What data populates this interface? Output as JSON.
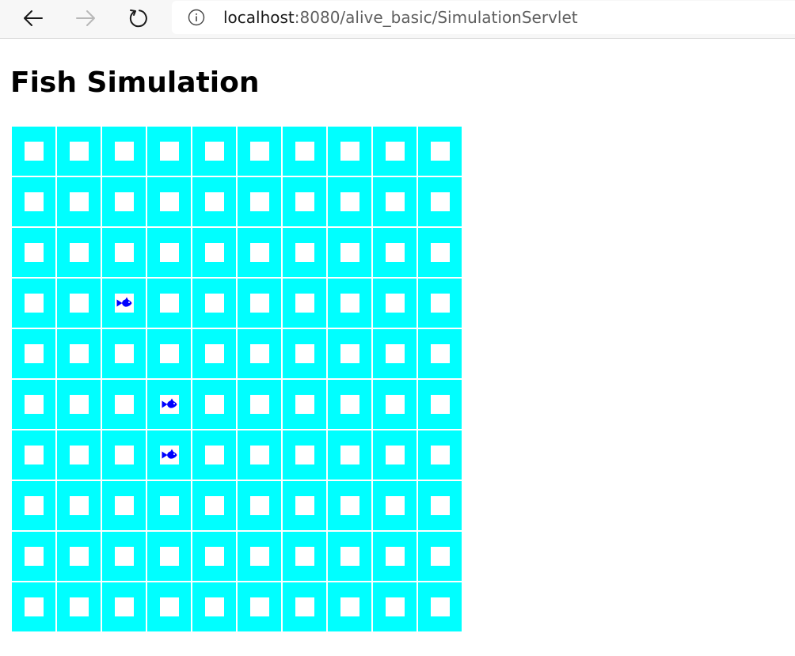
{
  "browser": {
    "url_host": "localhost",
    "url_rest": ":8080/alive_basic/SimulationServlet",
    "icons": {
      "back": "back-arrow-icon",
      "forward": "forward-arrow-icon",
      "reload": "reload-icon",
      "info": "info-icon"
    }
  },
  "page": {
    "title": "Fish Simulation"
  },
  "simulation": {
    "rows": 10,
    "cols": 10,
    "water_color": "#00ffff",
    "fish_color": "#0000ff",
    "fish": [
      {
        "row": 4,
        "col": 3
      },
      {
        "row": 6,
        "col": 4
      },
      {
        "row": 7,
        "col": 4
      }
    ]
  }
}
